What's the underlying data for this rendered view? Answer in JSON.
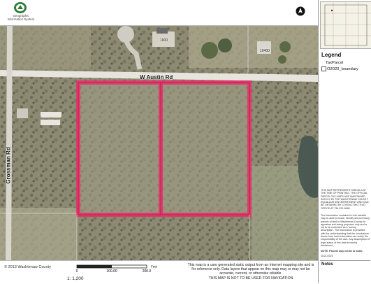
{
  "header": {
    "logo_text": "Geographic Information System",
    "north_arrow": "north-arrow-icon"
  },
  "map": {
    "roads": {
      "main_road": "W Austin Rd",
      "side_road": "Grossman Rd"
    },
    "house_numbers": [
      "1000",
      "10400"
    ],
    "parcel_color": "#e8306b",
    "road_color": "#e9e9e9"
  },
  "footer": {
    "copyright": "© 2013 Washtenaw County",
    "scale_ticks": [
      "0",
      "100.00",
      "200.0"
    ],
    "scale_unit": "Feet",
    "scale_ratio": "1: 1,200",
    "disclaimer_main": "This map is a user generated static output from an Internet mapping site and is for reference only. Data layers that appear on this map may or may not be accurate, current, or otherwise reliable.",
    "disclaimer_nav": "THIS MAP IS NOT TO BE USED FOR NAVIGATION"
  },
  "sidebar": {
    "legend_title": "Legend",
    "legend_items": [
      {
        "label": "TaxParcel",
        "color": "#ffffff"
      },
      {
        "label": "O2020_boundary",
        "color": "#ffffff"
      }
    ],
    "parcel_note": "THIS MAP REPRESENTS PARCELS AT THE TIME OF PRINTING. THE OFFICIAL PARCEL TAX MAPS ARE MAINTAINED SOLELY BY THE WASHTENAW COUNTY EQUALIZATION DEPARTMENT AND CAN BE OBTAINED BY CONTACTING THAT OFFICE AT 734-222-6660.",
    "info_note": "The information contained in this website map is used to locate, identify and inventory parcels of land in Washtenaw County for appraisal and taxing purposes only and is not to be construed as a 'survey description'. The information is provided with the understanding that the conclusions drawn from such information are solely the responsibility of the user. Any assumption of legal status of this data is hereby disclaimed.",
    "parcel_scale_note": "NOTE: Parcels may not be to scale.",
    "date": "11/21/2022",
    "notes_label": "Notes"
  }
}
